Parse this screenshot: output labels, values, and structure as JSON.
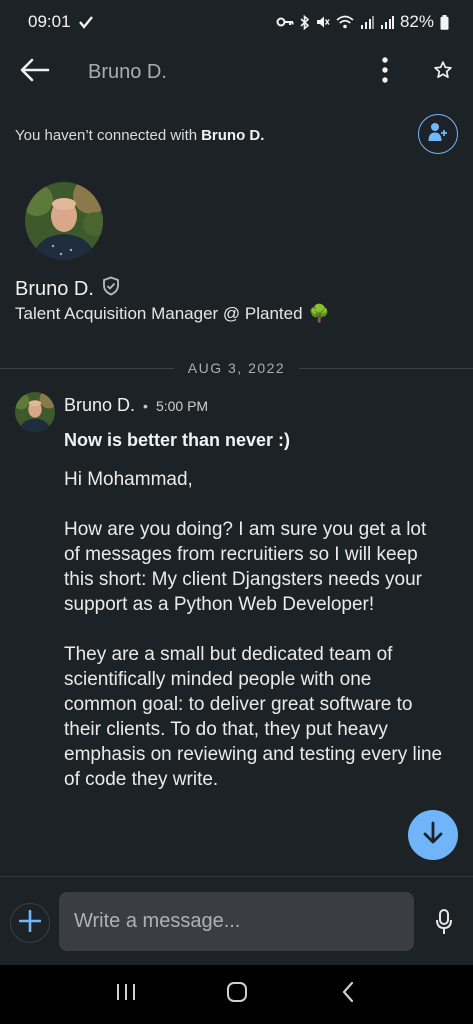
{
  "status_bar": {
    "time": "09:01",
    "battery_percent": "82%",
    "icons": [
      "nav-check-icon",
      "key-icon",
      "bluetooth-icon",
      "mute-icon",
      "wifi-icon",
      "signal-icon",
      "signal-icon",
      "battery-icon"
    ]
  },
  "header": {
    "title": "Bruno D.",
    "back_icon": "arrow-left-icon",
    "menu_icon": "more-vertical-icon",
    "star_icon": "star-outline-icon"
  },
  "connect_banner": {
    "prefix": "You haven’t connected with",
    "name": "Bruno D.",
    "button_icon": "add-person-icon"
  },
  "profile": {
    "name": "Bruno D.",
    "verified_icon": "shield-check-icon",
    "headline": "Talent Acquisition Manager @ Planted",
    "headline_emoji": "🌳"
  },
  "conversation": {
    "date": "AUG 3, 2022",
    "message": {
      "sender": "Bruno D.",
      "separator": "•",
      "time": "5:00 PM",
      "subject": "Now is better than never :)",
      "paragraphs": [
        "Hi Mohammad,",
        "How are you doing? I am sure you get a lot of messages from recruitiers so I will keep this short: My client Djangsters needs your support as a Python Web Developer!",
        "They are a small but dedicated team of scientifically minded people with one common goal: to deliver great software to their clients. To do that, they put heavy emphasis on reviewing and testing every line of code they write."
      ]
    }
  },
  "composer": {
    "placeholder": "Write a message...",
    "attach_icon": "plus-icon",
    "mic_icon": "microphone-icon"
  },
  "colors": {
    "background": "#1d2226",
    "accent": "#70b5f9",
    "input_bg": "#3a3e42"
  }
}
